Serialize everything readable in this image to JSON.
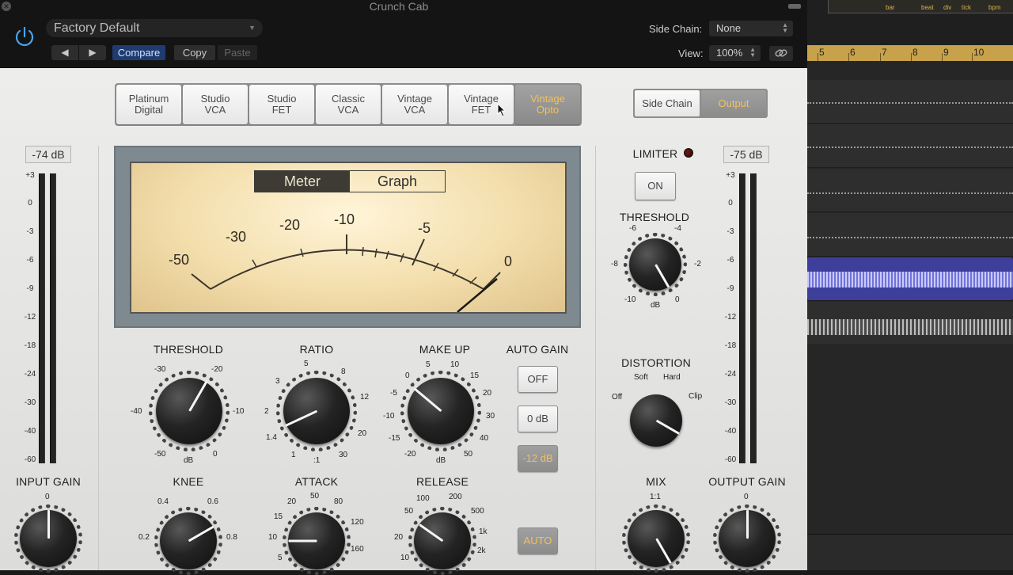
{
  "window": {
    "title": "Crunch Cab"
  },
  "header": {
    "preset_name": "Factory Default",
    "prev_label": "◀",
    "next_label": "▶",
    "compare_label": "Compare",
    "copy_label": "Copy",
    "paste_label": "Paste",
    "side_chain_label": "Side Chain:",
    "side_chain_value": "None",
    "view_label": "View:",
    "view_value": "100%"
  },
  "modes": [
    {
      "line1": "Platinum",
      "line2": "Digital"
    },
    {
      "line1": "Studio",
      "line2": "VCA"
    },
    {
      "line1": "Studio",
      "line2": "FET"
    },
    {
      "line1": "Classic",
      "line2": "VCA"
    },
    {
      "line1": "Vintage",
      "line2": "VCA"
    },
    {
      "line1": "Vintage",
      "line2": "FET"
    },
    {
      "line1": "Vintage",
      "line2": "Opto"
    }
  ],
  "active_mode": 6,
  "side_output": {
    "side_chain": "Side Chain",
    "output": "Output"
  },
  "input": {
    "readout": "-74 dB",
    "label": "INPUT GAIN",
    "top": "0"
  },
  "output": {
    "readout": "-75 dB",
    "label": "OUTPUT GAIN",
    "top": "0"
  },
  "meter_scale": [
    "+3",
    "0",
    "-3",
    "-6",
    "-9",
    "-12",
    "-18",
    "-24",
    "-30",
    "-40",
    "-60"
  ],
  "vu": {
    "tab_meter": "Meter",
    "tab_graph": "Graph",
    "scale": [
      "-50",
      "-30",
      "-20",
      "-10",
      "-5",
      "0"
    ]
  },
  "knobs": {
    "threshold": {
      "label": "THRESHOLD",
      "s": [
        "-30",
        "-20",
        "-40",
        "-10",
        "-50",
        "0",
        "dB"
      ]
    },
    "ratio": {
      "label": "RATIO",
      "s": [
        "5",
        "8",
        "3",
        "12",
        "2",
        "20",
        "1.4",
        "30",
        "1",
        ":1"
      ]
    },
    "makeup": {
      "label": "MAKE UP",
      "s": [
        "5",
        "10",
        "0",
        "15",
        "-5",
        "20",
        "-10",
        "30",
        "-15",
        "40",
        "-20",
        "50",
        "dB"
      ]
    },
    "knee": {
      "label": "KNEE",
      "s": [
        "0.4",
        "0.6",
        "0.2",
        "0.8"
      ]
    },
    "attack": {
      "label": "ATTACK",
      "s": [
        "50",
        "20",
        "80",
        "15",
        "120",
        "10",
        "160",
        "5"
      ]
    },
    "release": {
      "label": "RELEASE",
      "s": [
        "100",
        "200",
        "50",
        "500",
        "20",
        "1k",
        "10",
        "2k"
      ]
    },
    "limit_threshold": {
      "label": "THRESHOLD",
      "s": [
        "-6",
        "-4",
        "-8",
        "-2",
        "-10",
        "0",
        "dB"
      ]
    },
    "distortion": {
      "label": "DISTORTION",
      "s": [
        "Soft",
        "Hard",
        "Off",
        "Clip"
      ]
    },
    "mix": {
      "label": "MIX",
      "s": [
        "1:1"
      ]
    }
  },
  "auto_gain": {
    "label": "AUTO GAIN",
    "off": "OFF",
    "zero": "0 dB",
    "minus12": "-12 dB",
    "auto": "AUTO"
  },
  "limiter": {
    "label": "LIMITER",
    "on": "ON"
  },
  "daw": {
    "lcd": [
      "bar",
      "beat",
      "div",
      "tick",
      "bpm"
    ],
    "ruler": [
      "5",
      "6",
      "7",
      "8",
      "9",
      "10"
    ]
  },
  "colors": {
    "accent": "#f2c15a",
    "selected_region": "#3d3f9a"
  }
}
